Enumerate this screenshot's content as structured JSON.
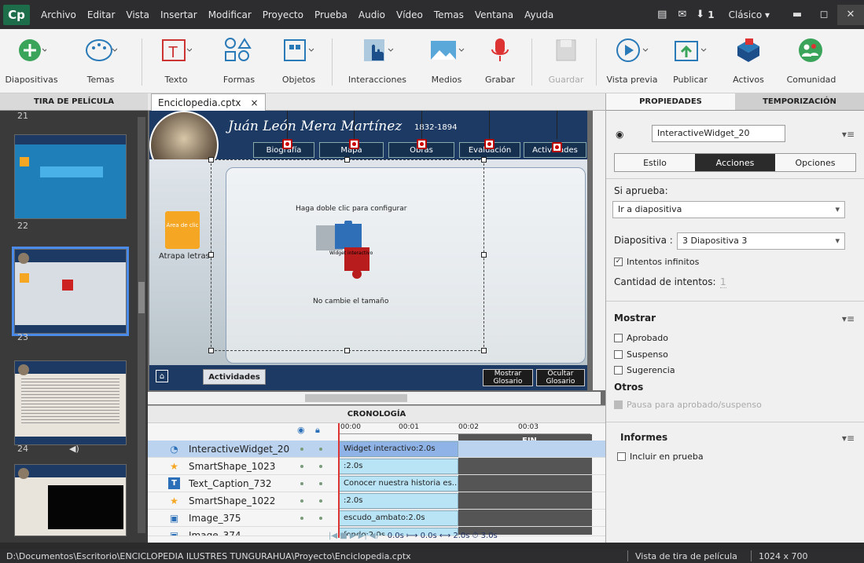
{
  "app": {
    "logo": "Cp",
    "workspace": "Clásico",
    "notif_count": "1"
  },
  "menu": [
    "Archivo",
    "Editar",
    "Vista",
    "Insertar",
    "Modificar",
    "Proyecto",
    "Prueba",
    "Audio",
    "Vídeo",
    "Temas",
    "Ventana",
    "Ayuda"
  ],
  "toolbar": {
    "diapositivas": "Diapositivas",
    "temas": "Temas",
    "texto": "Texto",
    "formas": "Formas",
    "objetos": "Objetos",
    "interacciones": "Interacciones",
    "medios": "Medios",
    "grabar": "Grabar",
    "guardar": "Guardar",
    "vista_previa": "Vista previa",
    "publicar": "Publicar",
    "activos": "Activos",
    "comunidad": "Comunidad"
  },
  "filmstrip": {
    "title": "TIRA DE PELÍCULA",
    "slides": [
      "21",
      "22",
      "23",
      "24"
    ]
  },
  "document_tab": {
    "name": "Enciclopedia.cptx",
    "close": "×"
  },
  "slide": {
    "title": "Juán León Mera Martínez",
    "years": "1832-1894",
    "nav": [
      "Biografía",
      "Mapa",
      "Obras",
      "Evaluación",
      "Actividades"
    ],
    "widget_hint": "Haga doble clic para configurar",
    "widget_hint2": "No cambie el tamaño",
    "widget_caption": "Widget interactivo",
    "basket_text": "Área de clic",
    "basket_label": "Atrapa letras",
    "bottom_btn": "Actividades",
    "glossary_show": "Mostrar Glosario",
    "glossary_hide": "Ocultar Glosario"
  },
  "timeline": {
    "title": "CRONOLOGÍA",
    "ruler": [
      "00:00",
      "00:01",
      "00:02",
      "00:03"
    ],
    "end_label": "FIN",
    "rows": [
      {
        "name": "InteractiveWidget_20",
        "bar": "Widget interactivo:2.0s",
        "icon": "◔"
      },
      {
        "name": "SmartShape_1023",
        "bar": ":2.0s",
        "icon": "★"
      },
      {
        "name": "Text_Caption_732",
        "bar": "Conocer nuestra historia es...",
        "icon": "T"
      },
      {
        "name": "SmartShape_1022",
        "bar": ":2.0s",
        "icon": "★"
      },
      {
        "name": "Image_375",
        "bar": "escudo_ambato:2.0s",
        "icon": "▣"
      },
      {
        "name": "Image_374",
        "bar": "fondo:2.0s",
        "icon": "▣"
      }
    ],
    "controls": "0.0s   ⟼ 0.0s   ⟷ 2.0s   ⏱ 3.0s"
  },
  "properties": {
    "tab_props": "PROPIEDADES",
    "tab_timing": "TEMPORIZACIÓN",
    "object_name": "InteractiveWidget_20",
    "seg": [
      "Estilo",
      "Acciones",
      "Opciones"
    ],
    "si_aprueba_label": "Si aprueba:",
    "si_aprueba_value": "Ir a diapositiva",
    "diapositiva_label": "Diapositiva :",
    "diapositiva_value": "3 Diapositiva 3",
    "intentos_infinitos": "Intentos infinitos",
    "cantidad_label": "Cantidad de intentos:",
    "cantidad_value": "1",
    "mostrar": "Mostrar",
    "aprobado": "Aprobado",
    "suspenso": "Suspenso",
    "sugerencia": "Sugerencia",
    "otros": "Otros",
    "pausa": "Pausa para aprobado/suspenso",
    "informes": "Informes",
    "incluir": "Incluir en prueba"
  },
  "status": {
    "path": "D:\\Documentos\\Escritorio\\ENCICLOPEDIA ILUSTRES TUNGURAHUA\\Proyecto\\Enciclopedia.cptx",
    "view": "Vista de tira de película",
    "resolution": "1024 x 700"
  },
  "colors": {
    "accent": "#1d6d4a",
    "slide_header": "#1c3a63",
    "selection": "#4a8ae8"
  }
}
